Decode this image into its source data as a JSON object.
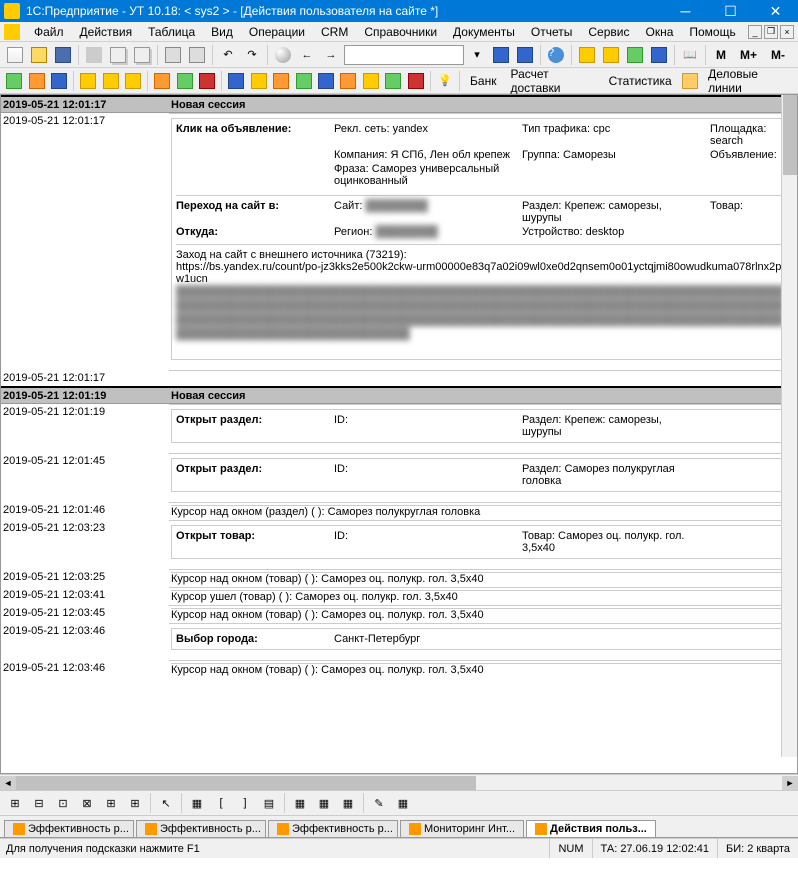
{
  "window": {
    "title": "1С:Предприятие - УТ 10.18:    < sys2 > - [Действия пользователя на сайте *]"
  },
  "menu": {
    "items": [
      "Файл",
      "Действия",
      "Таблица",
      "Вид",
      "Операции",
      "CRM",
      "Справочники",
      "Документы",
      "Отчеты",
      "Сервис",
      "Окна",
      "Помощь"
    ]
  },
  "toolbar3": {
    "bank": "Банк",
    "delivery": "Расчет доставки",
    "stats": "Статистика",
    "lines": "Деловые линии",
    "m": "M",
    "mplus": "M+",
    "mminus": "M-"
  },
  "sessions": [
    {
      "ts": "2019-05-21 12:01:17",
      "title": "Новая сессия",
      "rows": [
        {
          "ts": "2019-05-21 12:01:17",
          "type": "click",
          "click_label": "Клик на объявление:",
          "net_label": "Рекл. сеть:",
          "net": "yandex",
          "traffic_label": "Тип трафика:",
          "traffic": "cpc",
          "place_label": "Площадка:",
          "place": "search",
          "company_label": "Компания:",
          "company": "Я СПб, Лен обл крепеж",
          "group_label": "Группа:",
          "group": "Саморезы",
          "ad_label": "Объявление:",
          "phrase_label": "Фраза:",
          "phrase": "Саморез универсальный оцинкованный",
          "goto_label": "Переход на сайт в:",
          "site_label": "Сайт:",
          "section_label": "Раздел:",
          "section": "Крепеж: саморезы, шурупы",
          "product_label": "Товар:",
          "from_label": "Откуда:",
          "region_label": "Регион:",
          "device_label": "Устройство:",
          "device": "desktop",
          "entry_label": "Заход на сайт с внешнего источника (73219):",
          "url": "https://bs.yandex.ru/count/po-jz3kks2e500k2ckw-urm00000e83q7a02i09wl0xe0d2qnsem0o01yctqjmi80owudkuma078rlnx2pw1ucn"
        },
        {
          "ts": "2019-05-21 12:01:17",
          "type": "blank"
        }
      ]
    },
    {
      "ts": "2019-05-21 12:01:19",
      "title": "Новая сессия",
      "rows": [
        {
          "ts": "2019-05-21 12:01:19",
          "type": "open_section",
          "label": "Открыт раздел:",
          "id_label": "ID:",
          "section_label": "Раздел:",
          "section": "Крепеж: саморезы, шурупы"
        },
        {
          "ts": "2019-05-21 12:01:45",
          "type": "open_section",
          "label": "Открыт раздел:",
          "id_label": "ID:",
          "section_label": "Раздел:",
          "section": "Саморез полукруглая головка"
        },
        {
          "ts": "2019-05-21 12:01:46",
          "type": "cursor",
          "text": "Курсор над окном (раздел) (        ): Саморез полукруглая головка"
        },
        {
          "ts": "2019-05-21 12:03:23",
          "type": "open_product",
          "label": "Открыт товар:",
          "id_label": "ID:",
          "product_label": "Товар:",
          "product": "Саморез оц. полукр. гол. 3,5x40"
        },
        {
          "ts": "2019-05-21 12:03:25",
          "type": "cursor",
          "text": "Курсор над окном (товар) (          ): Саморез оц. полукр. гол. 3,5x40"
        },
        {
          "ts": "2019-05-21 12:03:41",
          "type": "cursor",
          "text": "Курсор ушел (товар) (          ): Саморез оц. полукр. гол. 3,5x40"
        },
        {
          "ts": "2019-05-21 12:03:45",
          "type": "cursor",
          "text": "Курсор над окном (товар) (          ): Саморез оц. полукр. гол. 3,5x40"
        },
        {
          "ts": "2019-05-21 12:03:46",
          "type": "city",
          "label": "Выбор города:",
          "city": "Санкт-Петербург"
        },
        {
          "ts": "2019-05-21 12:03:46",
          "type": "cursor",
          "text": "Курсор над окном (товар) (          ): Саморез оц. полукр. гол. 3,5x40"
        }
      ]
    }
  ],
  "tabs": {
    "items": [
      {
        "label": "Эффективность р...",
        "active": false
      },
      {
        "label": "Эффективность р...",
        "active": false
      },
      {
        "label": "Эффективность р...",
        "active": false
      },
      {
        "label": "Мониторинг Инт...",
        "active": false
      },
      {
        "label": "Действия польз...",
        "active": true
      }
    ]
  },
  "statusbar": {
    "hint": "Для получения подсказки нажмите F1",
    "num": "NUM",
    "ta": "ТА: 27.06.19   12:02:41",
    "bi": "БИ: 2 кварта"
  }
}
